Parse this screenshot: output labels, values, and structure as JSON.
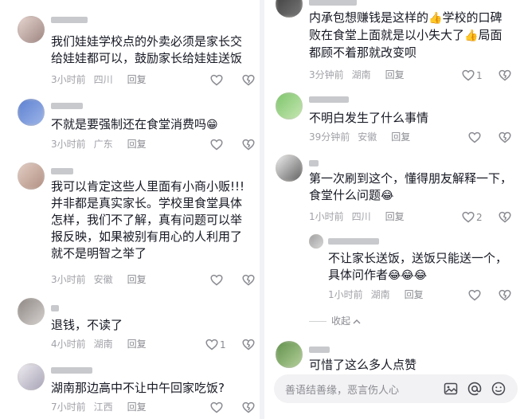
{
  "left_column": {
    "comments": [
      {
        "username": "",
        "text": "我们娃娃学校点的外卖必须是家长交\n给娃娃都可以，鼓励家长给娃娃送饭",
        "time": "3小时前",
        "location": "四川",
        "reply_label": "回复",
        "likes": ""
      },
      {
        "username": "",
        "text": "不就是要强制还在食堂消费吗",
        "emoji": "😁",
        "time": "3小时前",
        "location": "广东",
        "reply_label": "回复",
        "likes": ""
      },
      {
        "username": "",
        "text": "我可以肯定这些人里面有小商小贩!!!\n并非都是真实家长。学校里食堂具体\n怎样，我们不了解，真有问题可以举\n报反映，如果被别有用心的人利用了\n就不是明智之举了",
        "time": "3小时前",
        "location": "安徽",
        "reply_label": "回复",
        "likes": ""
      },
      {
        "username": "",
        "text": "退钱，不读了",
        "time": "4小时前",
        "location": "湖南",
        "reply_label": "回复",
        "likes": "1"
      },
      {
        "username": "",
        "text": "湖南那边高中不让中午回家吃饭?",
        "time": "7小时前",
        "location": "江西",
        "reply_label": "回复",
        "likes": ""
      }
    ]
  },
  "right_column": {
    "comments": [
      {
        "username": "",
        "text_parts": [
          "内承包想赚钱是这样的",
          "学校的口碑\n败在食堂上面就是以小失大了",
          "局面\n都顾不着那就改变呗"
        ],
        "emoji": "👍",
        "time": "3分钟前",
        "location": "湖南",
        "reply_label": "回复",
        "likes": "1"
      },
      {
        "username": "",
        "text": "不明白发生了什么事情",
        "time": "39分钟前",
        "location": "安徽",
        "reply_label": "回复",
        "likes": ""
      },
      {
        "username": "",
        "text": "第一次刷到这个，懂得朋友解释一下，\n食堂什么问题",
        "emoji": "😂",
        "time": "1小时前",
        "location": "四川",
        "reply_label": "回复",
        "likes": "2"
      },
      {
        "username": "",
        "text": "不让家长送饭，送饭只能送一个，\n具体问作者",
        "emoji": "😂😂😂",
        "time": "1小时前",
        "location": "湖南",
        "reply_label": "回复",
        "likes": ""
      },
      {
        "username": "",
        "text": "可惜了这么多人点赞",
        "time": "",
        "location": "",
        "reply_label": "",
        "likes": ""
      }
    ],
    "collapse_label": "收起",
    "input_placeholder": "善语结善缘，恶言伤人心"
  },
  "icons": {
    "like": "heart-outline-icon",
    "dislike": "broken-heart-icon",
    "image": "image-icon",
    "mention": "at-icon",
    "emoji": "smiley-icon"
  },
  "colors": {
    "meta_gray": "#a1a2a8",
    "text_dark": "#161823",
    "divider": "#f1f2f5"
  }
}
